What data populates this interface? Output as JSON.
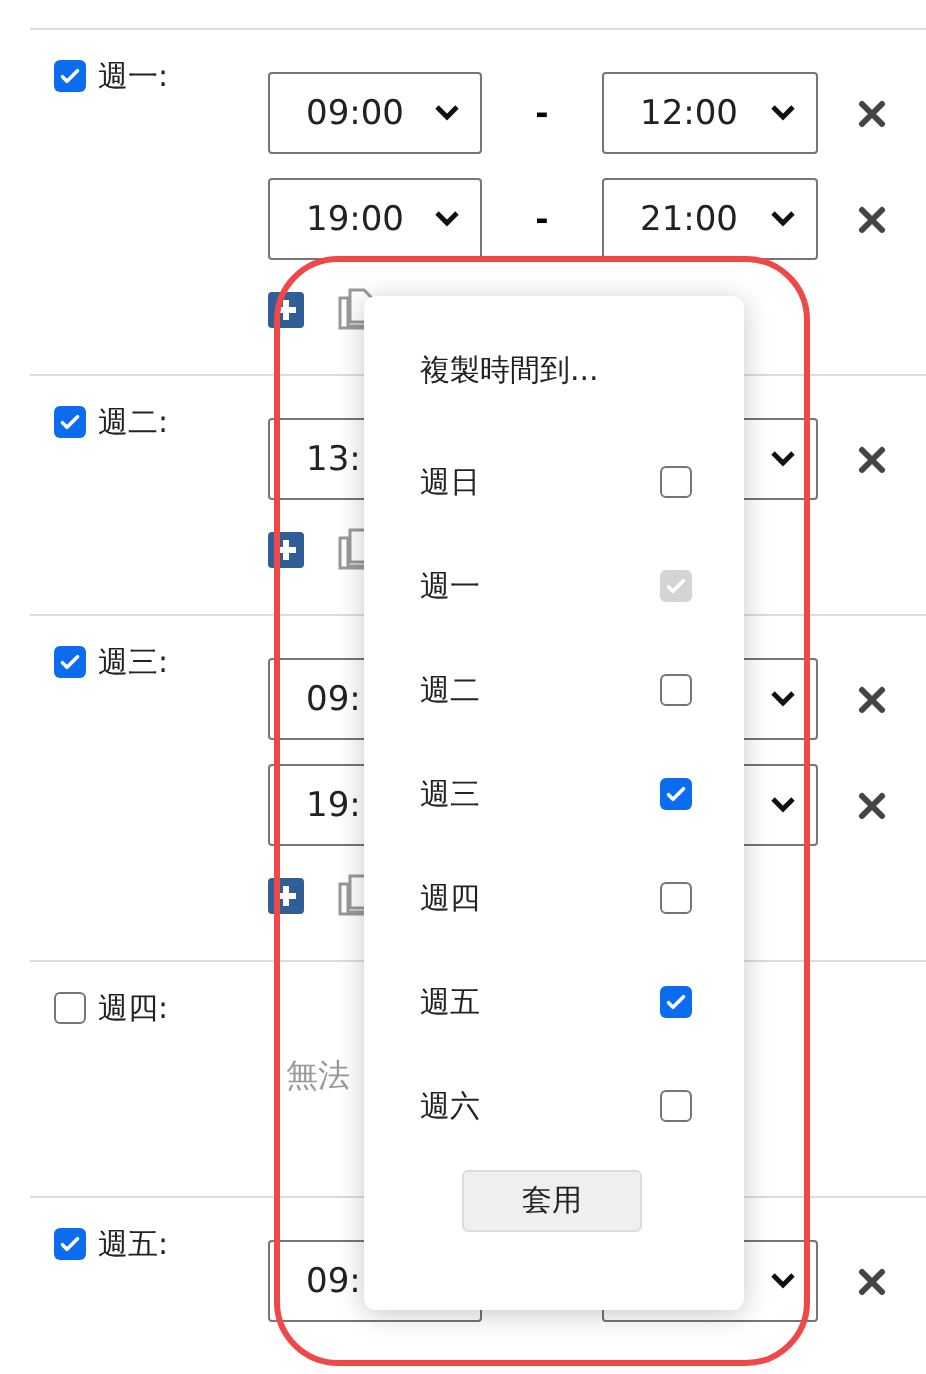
{
  "days": [
    {
      "label": "週一:",
      "checked": true,
      "slots": [
        {
          "start": "09:00",
          "separator": "-",
          "end": "12:00"
        },
        {
          "start": "19:00",
          "separator": "-",
          "end": "21:00"
        }
      ],
      "row_tools": true
    },
    {
      "label": "週二:",
      "checked": true,
      "slots": [
        {
          "start": "13:"
        }
      ],
      "row_tools": true
    },
    {
      "label": "週三:",
      "checked": true,
      "slots": [
        {
          "start": "09:"
        },
        {
          "start": "19:"
        }
      ],
      "row_tools": true
    },
    {
      "label": "週四:",
      "checked": false,
      "note": "無法"
    },
    {
      "label": "週五:",
      "checked": true,
      "slots": [
        {
          "start": "09:"
        }
      ]
    }
  ],
  "popup": {
    "title": "複製時間到...",
    "options": [
      {
        "label": "週日",
        "checked": false,
        "disabled": false
      },
      {
        "label": "週一",
        "checked": true,
        "disabled": true
      },
      {
        "label": "週二",
        "checked": false,
        "disabled": false
      },
      {
        "label": "週三",
        "checked": true,
        "disabled": false
      },
      {
        "label": "週四",
        "checked": false,
        "disabled": false
      },
      {
        "label": "週五",
        "checked": true,
        "disabled": false
      },
      {
        "label": "週六",
        "checked": false,
        "disabled": false
      }
    ],
    "button": "套用"
  }
}
